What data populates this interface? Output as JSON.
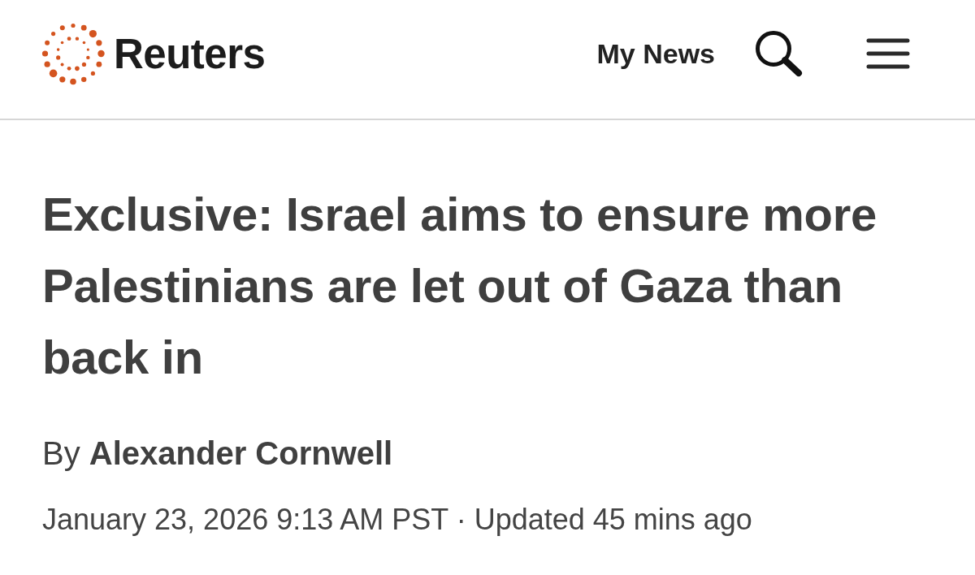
{
  "header": {
    "brand": "Reuters",
    "links": [
      "My News"
    ]
  },
  "article": {
    "headline": "Exclusive: Israel aims to ensure more Palestinians are let out of Gaza than back in",
    "byline": "By **Alexander Cornwell**",
    "dateline": "January 23, 2026 9:13 AM PST · Updated 45 mins ago"
  }
}
